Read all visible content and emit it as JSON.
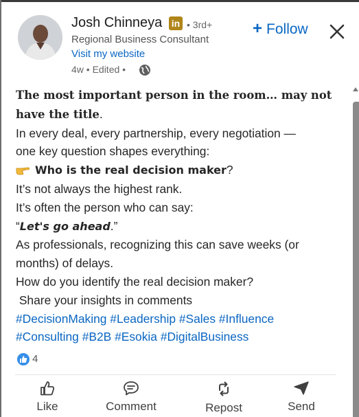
{
  "author": {
    "name": "Josh Chinneya",
    "badge": "in",
    "degree": "• 3rd+",
    "headline": "Regional Business Consultant",
    "website_label": "Visit my website",
    "time_meta": "4w • Edited •"
  },
  "follow_label": "Follow",
  "post": {
    "line1": "The most important person in the room… may not",
    "line2_bold": "have the title",
    "line2_tail": ".",
    "line3": "In every deal, every partnership, every negotiation —",
    "line4": "one key question shapes everything:",
    "line5_bold": "Who is the real decision maker",
    "line5_tail": "?",
    "line6": "It’s not always the highest rank.",
    "line7": "It’s often the person who can say:",
    "line8_open": "“",
    "line8_bold": "Let's go ahead",
    "line8_close": ".”",
    "line9": "As professionals, recognizing this can save weeks (or",
    "line10": "months) of delays.",
    "line11": "How do you identify the real decision maker?",
    "line12": " Share your insights in comments",
    "hashtags_row1": [
      "#DecisionMaking",
      "#Leadership",
      "#Sales",
      "#Influence"
    ],
    "hashtags_row2": [
      "#Consulting",
      "#B2B",
      "#Esokia",
      "#DigitalBusiness"
    ]
  },
  "reactions": {
    "count": "4",
    "icon": "thumbs-up-reaction-icon"
  },
  "actions": [
    {
      "label": "Like",
      "icon": "thumbs-up-icon"
    },
    {
      "label": "Comment",
      "icon": "comment-icon"
    },
    {
      "label": "Repost",
      "icon": "repost-icon"
    },
    {
      "label": "Send",
      "icon": "send-icon"
    }
  ],
  "colors": {
    "link_blue": "#0a66c2",
    "badge_gold": "#b08519",
    "text": "#262626",
    "muted": "#666666"
  }
}
